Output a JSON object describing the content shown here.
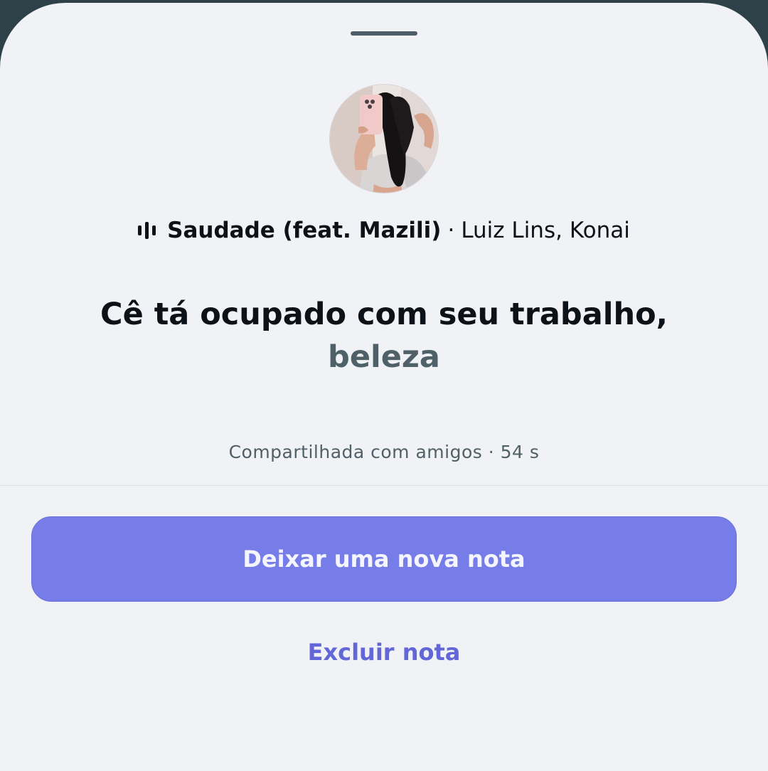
{
  "song": {
    "icon": "audio-waveform-icon",
    "title": "Saudade (feat. Mazili)",
    "separator": "·",
    "artists": "Luiz Lins, Konai"
  },
  "note": {
    "line1": "Cê tá ocupado com seu trabalho,",
    "line2": "beleza"
  },
  "shared": {
    "text": "Compartilhada com amigos · 54 s"
  },
  "actions": {
    "primary_label": "Deixar uma nova nota",
    "delete_label": "Excluir nota"
  },
  "colors": {
    "accent": "#767ce8",
    "link": "#6266d6",
    "background": "#f0f2f5"
  }
}
